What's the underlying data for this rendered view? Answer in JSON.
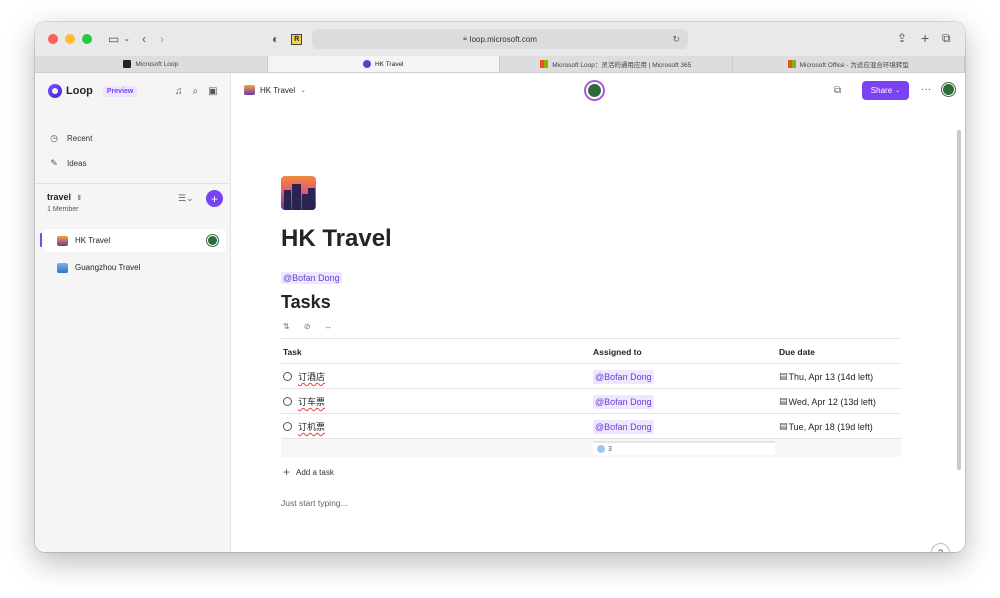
{
  "browser": {
    "url": "loop.microsoft.com",
    "tabs": [
      {
        "label": "Microsoft Loop",
        "active": false
      },
      {
        "label": "HK Travel",
        "active": true
      },
      {
        "label": "Microsoft Loop：灵活的通用应用 | Microsoft 365",
        "active": false
      },
      {
        "label": "Microsoft Office - 为适应混合环境转型",
        "active": false
      }
    ]
  },
  "sidebar": {
    "brand": "Loop",
    "badge": "Preview",
    "nav": [
      {
        "label": "Recent",
        "icon": "clock-icon"
      },
      {
        "label": "Ideas",
        "icon": "ideas-icon"
      }
    ],
    "workspace": {
      "name": "travel",
      "members": "1 Member"
    },
    "pages": [
      {
        "label": "HK Travel",
        "selected": true
      },
      {
        "label": "Guangzhou Travel",
        "selected": false
      }
    ]
  },
  "header": {
    "breadcrumb": "HK Travel",
    "share_label": "Share"
  },
  "document": {
    "title": "HK Travel",
    "mention": "@Bofan Dong",
    "section": "Tasks",
    "table": {
      "columns": [
        "Task",
        "Assigned to",
        "Due date"
      ],
      "rows": [
        {
          "task": "订酒店",
          "assignee": "@Bofan Dong",
          "due": "Thu, Apr 13 (14d left)"
        },
        {
          "task": "订车票",
          "assignee": "@Bofan Dong",
          "due": "Wed, Apr 12 (13d left)"
        },
        {
          "task": "订机票",
          "assignee": "@Bofan Dong",
          "due": "Tue, Apr 18 (19d left)"
        }
      ],
      "summary_count": "3"
    },
    "add_task_label": "Add a task",
    "placeholder": "Just start typing..."
  },
  "help_label": "?",
  "colors": {
    "accent": "#7a42f4",
    "mention_bg": "#efe7ff",
    "avatar": "#2f6b3a"
  }
}
